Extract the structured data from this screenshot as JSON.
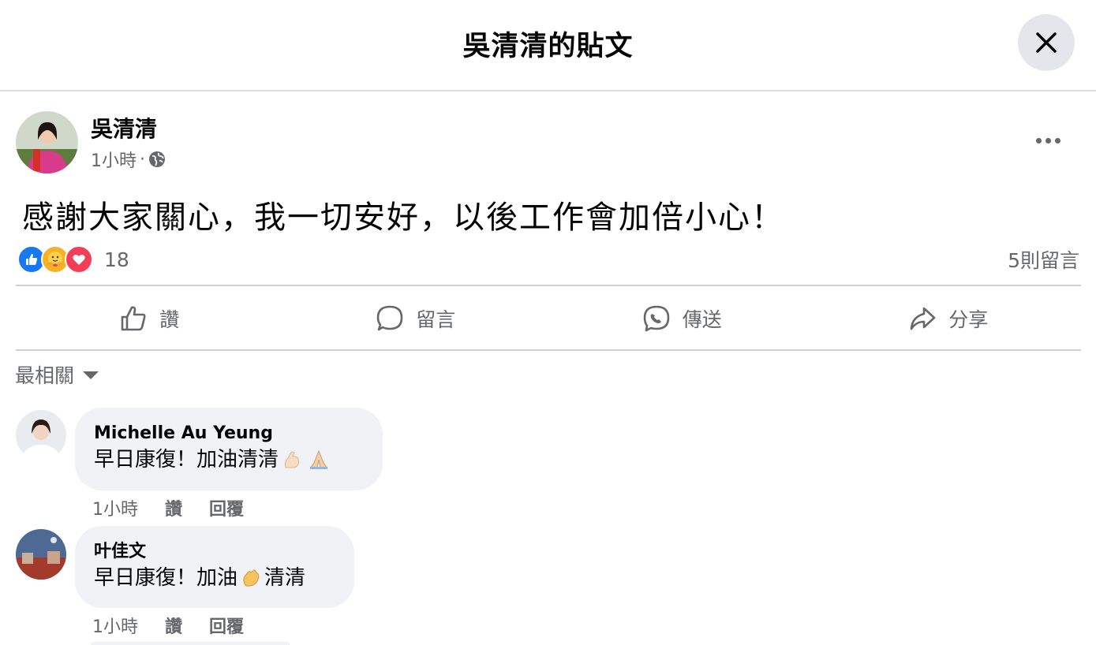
{
  "header": {
    "title": "吳清清的貼文"
  },
  "post": {
    "author": "吳清清",
    "time": "1小時",
    "separator": "·",
    "audience_icon": "globe-icon",
    "text": "感謝大家關心，我一切安好，以後工作會加倍小心！",
    "reaction_icons": [
      "like-icon",
      "care-icon",
      "love-icon"
    ],
    "reaction_count": "18",
    "comment_count": "5則留言"
  },
  "actions": [
    {
      "label": "讚",
      "icon": "thumbs-up-icon"
    },
    {
      "label": "留言",
      "icon": "comment-bubble-icon"
    },
    {
      "label": "傳送",
      "icon": "messenger-icon"
    },
    {
      "label": "分享",
      "icon": "share-arrow-icon"
    }
  ],
  "sort": {
    "label": "最相關"
  },
  "comments": [
    {
      "name": "Michelle Au Yeung",
      "text": "早日康復！加油清清",
      "emojis": [
        "flexed-biceps-emoji",
        "folded-hands-emoji"
      ],
      "time": "1小時",
      "like": "讚",
      "reply": "回覆"
    },
    {
      "name": "叶佳文",
      "text_before": "早日康復！加油",
      "emoji": "clapping-hands-emoji",
      "text_after": "清清",
      "time": "1小時",
      "like": "讚",
      "reply": "回覆"
    }
  ],
  "colors": {
    "secondary_text": "#65676b",
    "bubble": "#f0f2f5",
    "like_blue": "#1877f2",
    "love_red": "#f33e58",
    "care_yellow": "#f7b125",
    "divider": "#ced0d4"
  }
}
